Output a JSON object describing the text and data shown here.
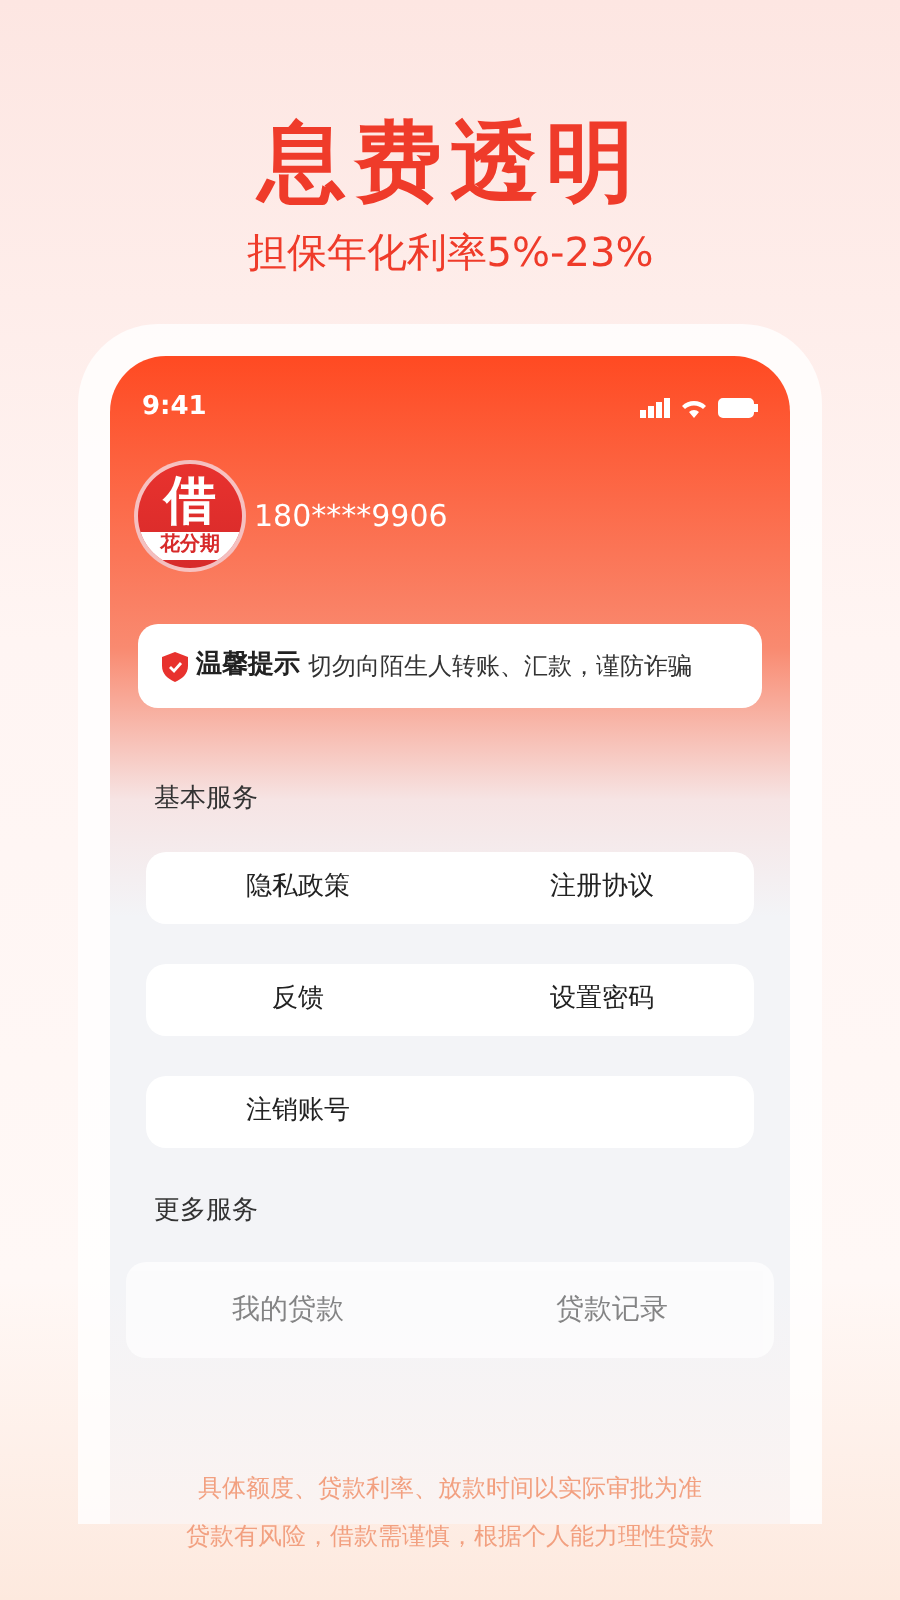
{
  "headline": "息费透明",
  "subheadline": "担保年化利率5%-23%",
  "status_bar": {
    "time": "9:41"
  },
  "profile": {
    "logo_char": "借",
    "logo_caption": "花分期",
    "phone": "180****9906"
  },
  "notice": {
    "title": "温馨提示",
    "text": "切勿向陌生人转账、汇款，谨防诈骗"
  },
  "sections": [
    {
      "title": "基本服务",
      "rows": [
        [
          "隐私政策",
          "注册协议"
        ],
        [
          "反馈",
          "设置密码"
        ],
        [
          "注销账号"
        ]
      ]
    },
    {
      "title": "更多服务",
      "rows": [
        [
          "我的贷款",
          "贷款记录"
        ]
      ]
    }
  ],
  "disclaimer": [
    "具体额度、贷款利率、放款时间以实际审批为准",
    "贷款有风险，借款需谨慎，根据个人能力理性贷款"
  ]
}
